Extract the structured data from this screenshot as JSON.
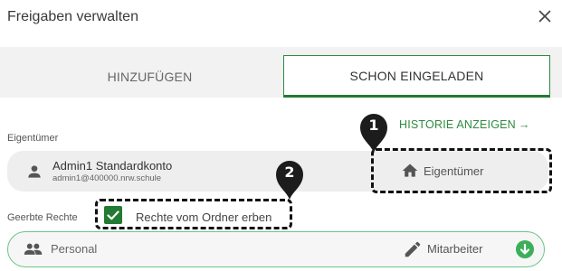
{
  "dialog": {
    "title": "Freigaben verwalten",
    "close_icon": "close-icon"
  },
  "tabs": [
    {
      "label": "HINZUFÜGEN",
      "active": false
    },
    {
      "label": "SCHON EINGELADEN",
      "active": true
    }
  ],
  "history_link": {
    "label": "HISTORIE ANZEIGEN",
    "arrow": "→"
  },
  "owner": {
    "section_label": "Eigentümer",
    "name": "Admin1 Standardkonto",
    "email": "admin1@400000.nrw.schule",
    "role": "Eigentümer",
    "icons": [
      "person-icon",
      "home-icon"
    ]
  },
  "inherited": {
    "section_label": "Geerbte Rechte",
    "checkbox_label": "Rechte vom Ordner erben",
    "checked": true
  },
  "permission_row": {
    "name": "Personal",
    "role": "Mitarbeiter",
    "icons": [
      "group-icon",
      "pencil-icon",
      "arrow-down-circle-icon"
    ]
  },
  "annotations": [
    {
      "number": "1"
    },
    {
      "number": "2"
    }
  ],
  "colors": {
    "accent": "#237a32",
    "accent_light": "#3caf5a",
    "field_bg": "#eeeeee",
    "tab_bar_bg": "#f2f2f2"
  }
}
